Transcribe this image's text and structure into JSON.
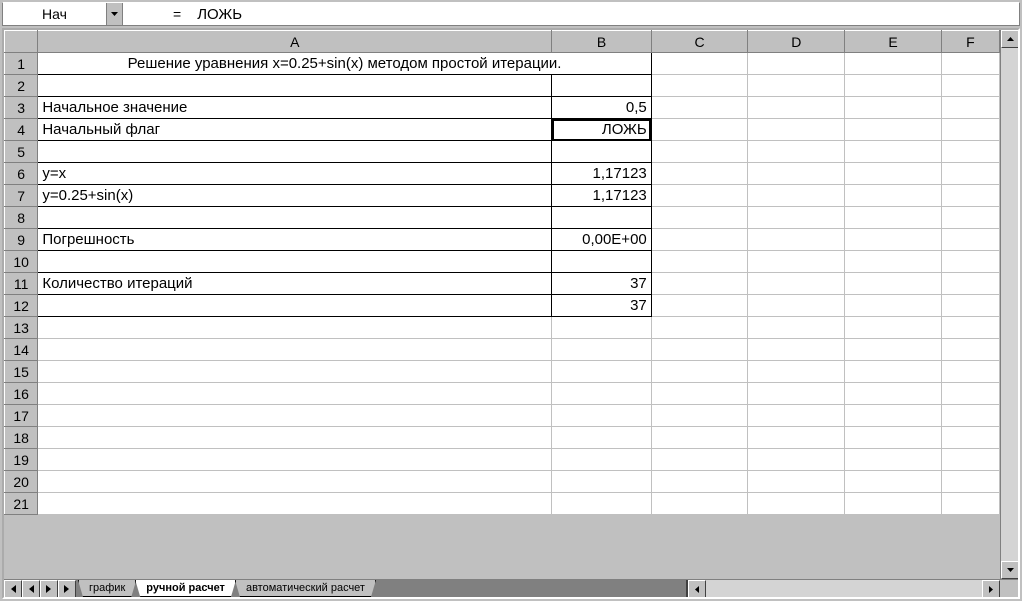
{
  "formula_bar": {
    "name_box": "Нач",
    "eq": "=",
    "formula": "ЛОЖЬ"
  },
  "columns": [
    "A",
    "B",
    "C",
    "D",
    "E",
    "F"
  ],
  "row_count": 21,
  "active_cell": {
    "row": 4,
    "col": "B"
  },
  "bordered_range": {
    "from_row": 1,
    "to_row": 12,
    "cols": [
      "A",
      "B"
    ]
  },
  "merged_A1": true,
  "cells": {
    "A1": {
      "v": "Решение уравнения x=0.25+sin(x) методом простой итерации.",
      "align": "center"
    },
    "A3": {
      "v": "Начальное значение",
      "align": "left"
    },
    "B3": {
      "v": "0,5",
      "align": "right"
    },
    "A4": {
      "v": "Начальный флаг",
      "align": "left"
    },
    "B4": {
      "v": "ЛОЖЬ",
      "align": "right"
    },
    "A6": {
      "v": "y=x",
      "align": "left"
    },
    "B6": {
      "v": "1,17123",
      "align": "right"
    },
    "A7": {
      "v": "y=0.25+sin(x)",
      "align": "left"
    },
    "B7": {
      "v": "1,17123",
      "align": "right"
    },
    "A9": {
      "v": "Погрешность",
      "align": "left"
    },
    "B9": {
      "v": "0,00E+00",
      "align": "right"
    },
    "A11": {
      "v": "Количество итераций",
      "align": "left"
    },
    "B11": {
      "v": "37",
      "align": "right"
    },
    "B12": {
      "v": "37",
      "align": "right"
    }
  },
  "tabs": {
    "items": [
      "график",
      "ручной расчет",
      "автоматический расчет"
    ],
    "active_index": 1
  }
}
